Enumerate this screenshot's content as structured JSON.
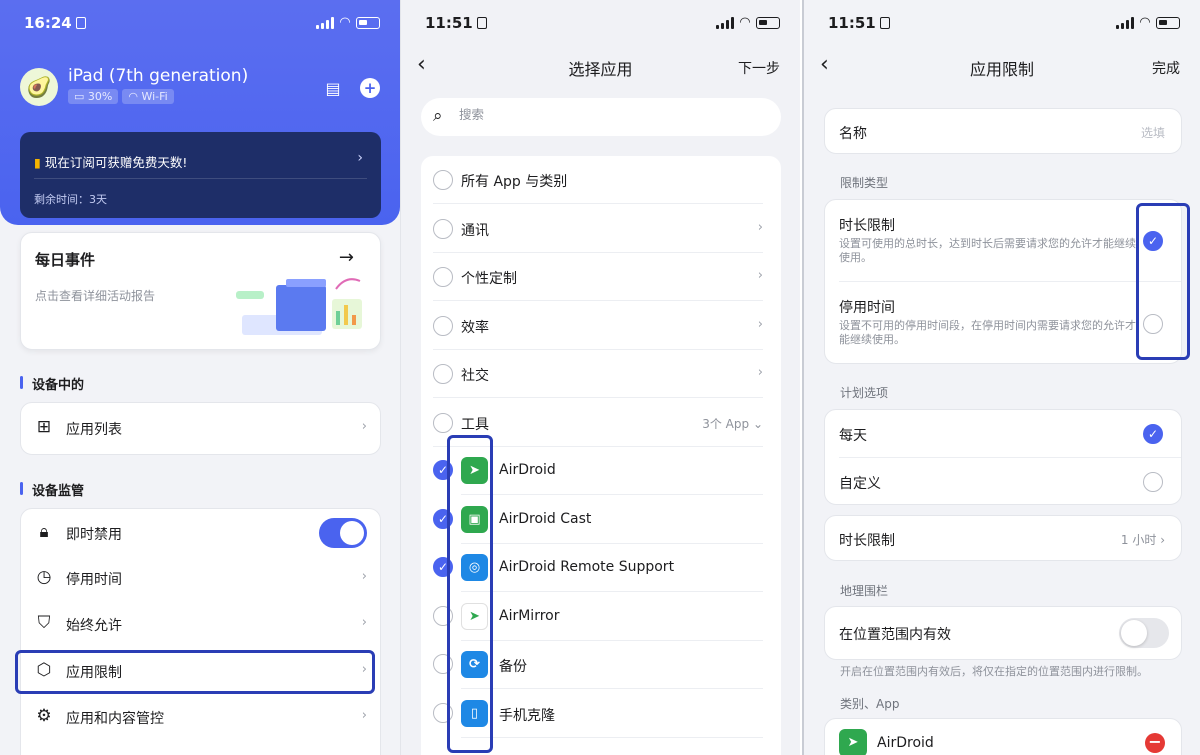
{
  "panel1": {
    "status": {
      "time": "16:24"
    },
    "device": {
      "name": "iPad (7th generation)",
      "battery": "30%",
      "network": "Wi-Fi"
    },
    "promo": {
      "text": "现在订阅可获赠免费天数!",
      "remaining": "剩余时间：3天"
    },
    "daily": {
      "title": "每日事件",
      "subtitle": "点击查看详细活动报告"
    },
    "section_device": "设备中的",
    "app_list": "应用列表",
    "section_monitor": "设备监管",
    "menu": [
      {
        "label": "即时禁用",
        "icon": "lock-icon"
      },
      {
        "label": "停用时间",
        "icon": "clock-icon"
      },
      {
        "label": "始终允许",
        "icon": "shield-check-icon"
      },
      {
        "label": "应用限制",
        "icon": "app-limit-icon"
      },
      {
        "label": "应用和内容管控",
        "icon": "content-control-icon"
      }
    ],
    "colors": {
      "accent": "#4a63ef",
      "header": "#5b6ef0",
      "promo_bg": "#1e2e68",
      "highlight": "#2a3db5"
    }
  },
  "panel2": {
    "status": {
      "time": "11:51"
    },
    "title": "选择应用",
    "next": "下一步",
    "search_placeholder": "搜索",
    "categories": [
      {
        "label": "所有 App 与类别"
      },
      {
        "label": "通讯"
      },
      {
        "label": "个性定制"
      },
      {
        "label": "效率"
      },
      {
        "label": "社交"
      },
      {
        "label": "工具",
        "count": "3个 App"
      }
    ],
    "apps": [
      {
        "label": "AirDroid",
        "checked": true,
        "color": "#2fa84f",
        "icon": "airdroid-icon"
      },
      {
        "label": "AirDroid Cast",
        "checked": true,
        "color": "#2fa84f",
        "icon": "airdroid-cast-icon"
      },
      {
        "label": "AirDroid Remote Support",
        "checked": true,
        "color": "#1e88e5",
        "icon": "airdroid-remote-support-icon"
      },
      {
        "label": "AirMirror",
        "checked": false,
        "color": "#ffffff",
        "icon": "airmirror-icon"
      },
      {
        "label": "备份",
        "checked": false,
        "color": "#1e88e5",
        "icon": "backup-icon"
      },
      {
        "label": "手机克隆",
        "checked": false,
        "color": "#1e88e5",
        "icon": "phone-clone-icon"
      }
    ]
  },
  "panel3": {
    "status": {
      "time": "11:51"
    },
    "title": "应用限制",
    "done": "完成",
    "name_label": "名称",
    "name_placeholder": "选填",
    "limit_type_label": "限制类型",
    "limit_types": [
      {
        "title": "时长限制",
        "desc": "设置可使用的总时长，达到时长后需要请求您的允许才能继续使用。",
        "selected": true
      },
      {
        "title": "停用时间",
        "desc": "设置不可用的停用时间段，在停用时间内需要请求您的允许才能继续使用。",
        "selected": false
      }
    ],
    "plan_label": "计划选项",
    "plans": [
      {
        "title": "每天",
        "selected": true
      },
      {
        "title": "自定义",
        "selected": false
      }
    ],
    "duration": {
      "label": "时长限制",
      "value": "1 小时"
    },
    "geofence_label": "地理围栏",
    "geofence": {
      "label": "在位置范围内有效",
      "note": "开启在位置范围内有效后，将仅在指定的位置范围内进行限制。"
    },
    "apps_label": "类别、App",
    "apps": [
      {
        "label": "AirDroid"
      }
    ]
  }
}
